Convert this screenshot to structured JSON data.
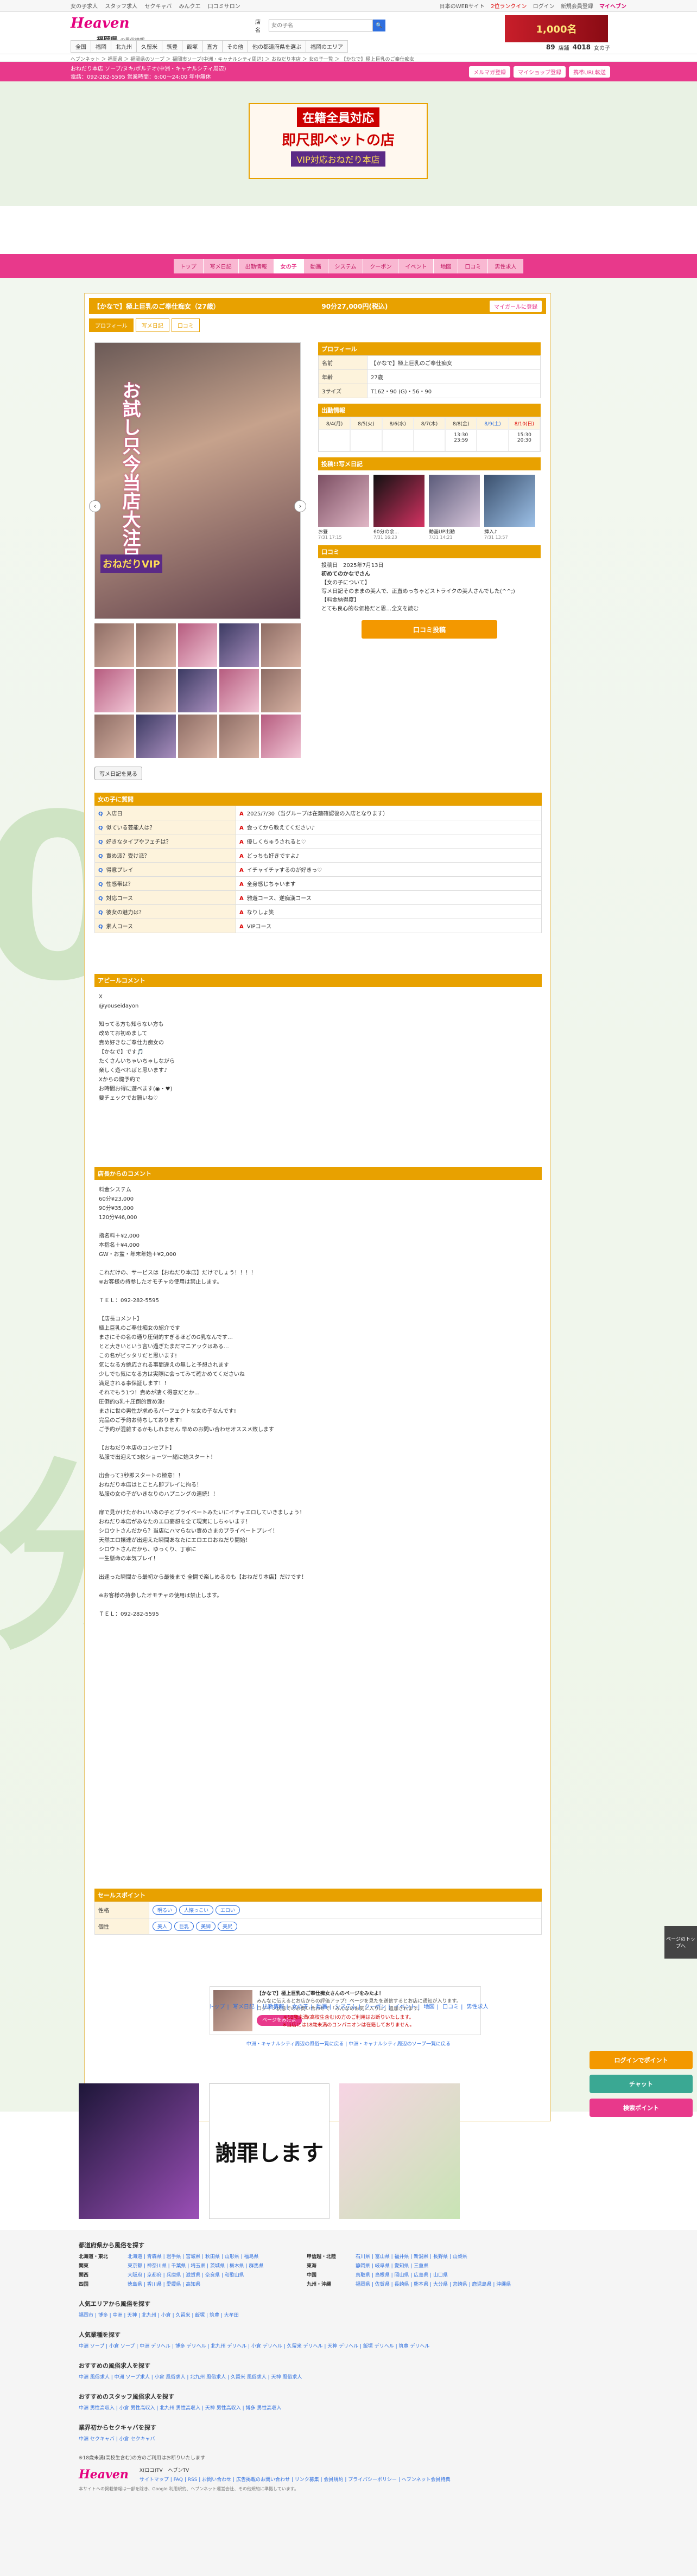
{
  "topbar": {
    "left": [
      "女の子求人",
      "スタッフ求人",
      "セクキャバ",
      "みんクエ",
      "口コミサロン"
    ],
    "right": [
      "日本のWEBサイト",
      "2位ランクイン",
      "ログイン",
      "新規会員登録"
    ],
    "myheaven": "マイヘブン"
  },
  "header": {
    "logo": "Heaven",
    "pref": "福岡県",
    "pref_sub": "の風俗情報",
    "search_label": "店名",
    "search_placeholder": "女の子名",
    "banner": "1,000名",
    "count_label1": "店舗",
    "count_val1": "89",
    "count_label2": "女の子",
    "count_val2": "4018"
  },
  "gnav": [
    "全国",
    "福岡",
    "北九州",
    "久留米",
    "筑豊",
    "飯塚",
    "直方",
    "その他",
    "他の都道府県を選ぶ",
    "福岡のエリア"
  ],
  "breadcrumb": "ヘブンネット ＞ 福岡県 ＞ 福岡県のソープ ＞ 福岡市ソープ(中洲・キャナルシティ周辺) ＞ おねだり本店 ＞ 女の子一覧 ＞ 【かなで】極上巨乳のご奉仕痴女",
  "pinkbar": {
    "line1": "おねだり本店 ソープ/ヌキ/ポルチオ(中洲・キャナルシティ周辺)",
    "line2": "電話：092-282-5595 営業時間：6:00〜24:00 年中無休",
    "btns": [
      "メルマガ登録",
      "マイショップ登録",
      "携帯URL転送"
    ]
  },
  "hero": {
    "t1": "在籍全員対応",
    "t2": "即尺即ベットの店",
    "t3": "VIP対応おねだり本店",
    "bg": "分"
  },
  "shopnav": [
    "トップ",
    "写メ日記",
    "出勤情報",
    "女の子",
    "動画",
    "システム",
    "クーポン",
    "イベント",
    "地図",
    "口コミ",
    "男性求人"
  ],
  "girl": {
    "title": "【かなで】極上巨乳のご奉仕痴女（27歳）",
    "price": "90分27,000円(税込)",
    "fav": "マイガールに登録",
    "tabs": [
      "プロフィール",
      "写メ日記",
      "口コミ"
    ],
    "photo_text": "お試し只今当店大注目",
    "vip": "おねだりVIP",
    "diary_btn": "写メ日記を見る"
  },
  "profile": {
    "header": "プロフィール",
    "rows": [
      {
        "k": "名前",
        "v": "【かなで】極上巨乳のご奉仕痴女"
      },
      {
        "k": "年齢",
        "v": "27歳"
      },
      {
        "k": "3サイズ",
        "v": "T162・90 (G)・56・90"
      }
    ]
  },
  "schedule": {
    "header": "出勤情報",
    "days": [
      "8/4(月)",
      "8/5(火)",
      "8/6(水)",
      "8/7(木)",
      "8/8(金)",
      "8/9(土)",
      "8/10(日)"
    ],
    "times": [
      "",
      "",
      "",
      "",
      "13:30\n23:59",
      "",
      "15:30\n20:30"
    ]
  },
  "diary": {
    "header": "投稿!!写メ日記",
    "items": [
      {
        "t": "お昼",
        "d": "7/31 17:15"
      },
      {
        "t": "60分の余...",
        "d": "7/31 16:23"
      },
      {
        "t": "動画UP出勤",
        "d": "7/31 14:21"
      },
      {
        "t": "挿入♪",
        "d": "7/31 13:57"
      }
    ]
  },
  "review": {
    "header": "口コミ",
    "date": "投稿日　2025年7月13日",
    "title": "初めてのかなでさん",
    "body": "【女の子について】\n写メ日記そのままの美人で、正直めっちゃどストライクの美人さんでした(^^;)\n【料金納得度】\nとても良心的な価格だと思…全文を読む",
    "btn": "口コミ投稿"
  },
  "qa": {
    "header": "女の子に質問",
    "rows": [
      {
        "q": "入店日",
        "a": "2025/7/30（当グループは在籍確認後の入店となります）"
      },
      {
        "q": "似ている芸能人は？",
        "a": "会ってから教えてください♪"
      },
      {
        "q": "好きなタイプやフェチは？",
        "a": "優しくちゅうされると♡"
      },
      {
        "q": "責め派？受け派？",
        "a": "どっちも好きですよ♪"
      },
      {
        "q": "得意プレイ",
        "a": "イチャイチャするのが好きっ♡"
      },
      {
        "q": "性感帯は？",
        "a": "全身感じちゃいます"
      },
      {
        "q": "対応コース",
        "a": "雅遊コース、逆痴漢コース"
      },
      {
        "q": "彼女の魅力は？",
        "a": "なりしょ笑"
      },
      {
        "q": "素人コース",
        "a": "VIPコース"
      }
    ]
  },
  "apeal": {
    "header": "アピールコメント",
    "body": "X\n@youseidayon\n\n知ってる方も知らない方も\n改めてお初めまして\n責め好きなご奉仕力痴女の\n【かなで】です🎵\nたくさんいちゃいちゃしながら\n楽しく遊べればと思います♪\nXからの鍵予約で\nお時間お得に遊べます(◉・♥)\n要チェックでお願いね♡"
  },
  "shop": {
    "header": "店長からのコメント",
    "body": "料金システム\n60分¥23,000\n90分¥35,000\n120分¥46,000\n\n指名料＋¥2,000\n本指名＋¥4,000\nGW・お盆・年末年始＋¥2,000\n\nこれだけの、サービスは【おねだり本店】だけでしょう！！！！\n※お客様の持参したオモチャの使用は禁止します。\n\nＴＥＬ：092-282-5595\n\n【店長コメント】\n極上巨乳のご奉仕痴女の紹介です\nまさにその名の通り圧倒的すぎるほどのG乳なんです…\nとと大きいという言い過ぎたまだマニアックはある…\nこの名がピッタリだと思います!\n気になる方絶応される事間違えの無しと予想されます\n少しでも気になる方は実際に会ってみて確かめてくださいね\n満足される事保証します！！\nそれでもう1つ！責めが凄く得意だとか…\n圧倒的G乳＋圧倒的責め派!\nまさに世の男性が求めるパーフェクトな女の子なんです!\n完品のご予約お待ちしております!\nご予約が混雑するかもしれません 早めのお問い合わせオススメ致します\n\n【おねだり本店のコンセプト】\n私服で出迎えて3枚ショーツ一緒に始スタート！\n\n出会って3秒即スタートの極意！！\nおねだり本店はとことん即プレイに拘る！\n私服の女の子がいきなりのハプニングの連続！！\n\n扉で見かけたかわいいあの子とプライベートみたいにイチャエロしていきましょう！\nおねだり本店があなたのエロ妄想を全て現実にしちゃいます！\nシロウトさんだから？当店にハマらない責めさまのプライベートプレイ！\n天然エロ嬢達が出迎えた瞬間あなたにエロエロおねだり開始！\nシロウトさんだから、ゆっくり、丁寧に\n一生懸命の本気プレイ！\n\n出逢った瞬間から最初から最後まで 全開で楽しめるのも【おねだり本店】だけです！\n\n※お客様の持参したオモチャの使用は禁止します。\n\nＴＥＬ：092-282-5595"
  },
  "sales": {
    "header": "セールスポイント",
    "rows": [
      {
        "k": "性格",
        "tags": [
          "明るい",
          "人懐っこい",
          "エロい"
        ]
      },
      {
        "k": "個性",
        "tags": [
          "美人",
          "巨乳",
          "美脚",
          "美尻"
        ]
      }
    ]
  },
  "share": {
    "title": "【かなで】極上巨乳のご奉仕痴女さんのページをみたよ！",
    "body": "みんなに伝えるとお店からの評価アップ！ページを見たを送信するとお店に通知が入ります。\nログイン状態でのお問い合わせで「みんなのお気に入りに」追加されます。",
    "btn": "ページをみたよ"
  },
  "footnav": [
    "トップ",
    "写メ日記",
    "出勤情報",
    "女の子",
    "動画",
    "システム",
    "クーポン",
    "イベント",
    "地図",
    "口コミ",
    "男性求人"
  ],
  "footnote": "※18歳未満(高校生含む)の方のご利用はお断りいたします。\n※当店には18歳未満のコンパニオンは在籍しておりません。",
  "footlinks": [
    "中洲・キャナルシティ周辺の風俗一覧に戻る",
    "中洲・キャナルシティ周辺のソープ一覧に戻る"
  ],
  "ads": {
    "ad2": "謝罪します"
  },
  "floats": {
    "login": "ログインでポイント",
    "chat": "チャット",
    "search": "検索ポイント",
    "top": "ページのトップへ"
  },
  "footer": {
    "sec1": "都道府県から風俗を探す",
    "areas": [
      {
        "k": "北海道・東北",
        "v": "北海道 | 青森県 | 岩手県 | 宮城県 | 秋田県 | 山形県 | 福島県"
      },
      {
        "k": "甲信越・北陸",
        "v": "石川県 | 富山県 | 福井県 | 新潟県 | 長野県 | 山梨県"
      },
      {
        "k": "関東",
        "v": "東京都 | 神奈川県 | 千葉県 | 埼玉県 | 茨城県 | 栃木県 | 群馬県"
      },
      {
        "k": "東海",
        "v": "静岡県 | 岐阜県 | 愛知県 | 三重県"
      },
      {
        "k": "関西",
        "v": "大阪府 | 京都府 | 兵庫県 | 滋賀県 | 奈良県 | 和歌山県"
      },
      {
        "k": "中国",
        "v": "鳥取県 | 島根県 | 岡山県 | 広島県 | 山口県"
      },
      {
        "k": "四国",
        "v": "徳島県 | 香川県 | 愛媛県 | 高知県"
      },
      {
        "k": "九州・沖縄",
        "v": "福岡県 | 佐賀県 | 長崎県 | 熊本県 | 大分県 | 宮崎県 | 鹿児島県 | 沖縄県"
      }
    ],
    "sec2": "人気エリアから風俗を探す",
    "sec2v": "福岡市 | 博多 | 中洲 | 天神 | 北九州 | 小倉 | 久留米 | 飯塚 | 筑豊 | 大牟田",
    "sec3": "人気業種を探す",
    "sec3v": "中洲 ソープ | 小倉 ソープ | 中洲 デリヘル | 博多 デリヘル | 北九州 デリヘル | 小倉 デリヘル | 久留米 デリヘル | 天神 デリヘル | 飯塚 デリヘル | 筑豊 デリヘル",
    "sec4": "おすすめの風俗求人を探す",
    "sec4v": "中洲 風俗求人 | 中洲 ソープ求人 | 小倉 風俗求人 | 北九州 風俗求人 | 久留米 風俗求人 | 天神 風俗求人",
    "sec5": "おすすめのスタッフ風俗求人を探す",
    "sec5v": "中洲 男性高収入 | 小倉 男性高収入 | 北九州 男性高収入 | 天神 男性高収入 | 博多 男性高収入",
    "sec6": "業界初からセクキャバを探す",
    "sec6v": "中洲 セクキャバ | 小倉 セクキャバ",
    "warn": "※18歳未満(高校生含む)の方のご利用はお断りいたします",
    "logo": "Heaven",
    "xlogo": "X(ロコ)TV",
    "ytlogo": "ヘブンTV",
    "links": "サイトマップ | FAQ | RSS | お問い合わせ | 広告掲載のお問い合わせ | リンク募集 | 会員規約 | プライバシーポリシー | ヘブンネット会員特典",
    "copy": "本サイトへの掲載情報は一部を除き、Google 利用規約、ヘブンネット運営会社、その他規約に準拠しています。"
  }
}
